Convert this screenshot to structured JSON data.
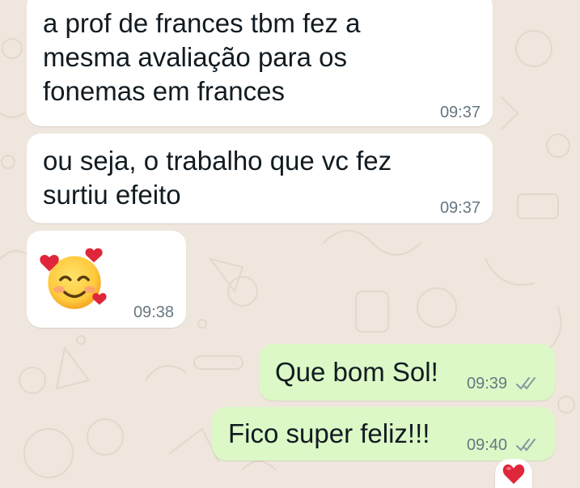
{
  "messages": [
    {
      "text": "a prof de frances tbm fez a\nmesma avaliação para os\nfonemas em frances",
      "time": "09:37",
      "direction": "incoming"
    },
    {
      "text": "ou seja, o trabalho que vc fez\nsurtiu efeito",
      "time": "09:37",
      "direction": "incoming"
    },
    {
      "emoji": "smiling-face-with-hearts",
      "time": "09:38",
      "direction": "incoming"
    },
    {
      "text": "Que bom Sol!",
      "time": "09:39",
      "direction": "outgoing",
      "status": "read-double-check-icon"
    },
    {
      "text": "Fico super feliz!!!",
      "time": "09:40",
      "direction": "outgoing",
      "status": "read-double-check-icon",
      "reaction": "red-heart"
    }
  ],
  "colors": {
    "wallpaper": "#efe7dd",
    "incoming_bubble": "#ffffff",
    "outgoing_bubble": "#dcf8c6",
    "text": "#111b21",
    "meta": "#667781",
    "read_ticks": "#8696a0",
    "heart": "#e0263a"
  }
}
